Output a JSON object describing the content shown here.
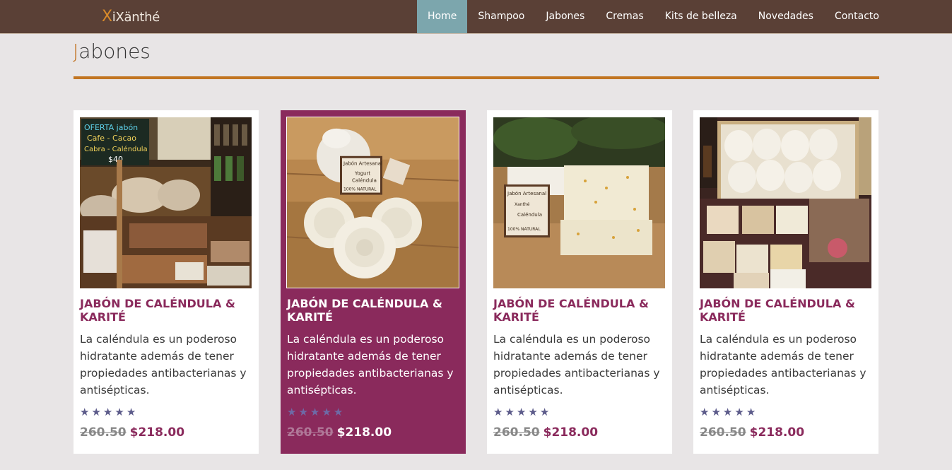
{
  "brand": {
    "logo_initial": "X",
    "logo_rest": "iXänthé"
  },
  "nav": [
    {
      "label": "Home",
      "active": true
    },
    {
      "label": "Shampoo"
    },
    {
      "label": "Jabones"
    },
    {
      "label": "Cremas"
    },
    {
      "label": "Kits de belleza"
    },
    {
      "label": "Novedades"
    },
    {
      "label": "Contacto"
    }
  ],
  "section": {
    "title_first": "J",
    "title_rest": "abones"
  },
  "products": [
    {
      "image": "soap-stall-photo",
      "title": "JABÓN DE CALÉNDULA & KARITÉ",
      "description": "La caléndula es un poderoso hidratante además de tener propiedades antibacterianas y antisépticas.",
      "rating": "5",
      "old_price": "260.50",
      "price": "$218.00"
    },
    {
      "image": "calendula-yogurt-soap-photo",
      "title": "JABÓN DE CALÉNDULA & KARITÉ",
      "description": "La caléndula es un poderoso hidratante además de tener propiedades antibacterianas y antisépticas.",
      "rating": "5",
      "old_price": "260.50",
      "price": "$218.00"
    },
    {
      "image": "calendula-bar-soap-photo",
      "title": "JABÓN DE CALÉNDULA & KARITÉ",
      "description": "La caléndula es un poderoso hidratante además de tener propiedades antibacterianas y antisépticas.",
      "rating": "5",
      "old_price": "260.50",
      "price": "$218.00"
    },
    {
      "image": "soap-box-display-photo",
      "title": "JABÓN DE CALÉNDULA & KARITÉ",
      "description": "La caléndula es un poderoso hidratante además de tener propiedades antibacterianas y antisépticas.",
      "rating": "5",
      "old_price": "260.50",
      "price": "$218.00"
    }
  ],
  "photo_text": {
    "sign": [
      "OFERTA jabón",
      "Cafe - Cacao",
      "Cabra - Caléndula",
      "$40"
    ],
    "label2": [
      "Jabón Artesanal",
      "Yogurt",
      "Caléndula",
      "100% NATURAL"
    ],
    "label3": [
      "Jabón Artesanal",
      "Xanthé",
      "Caléndula",
      "100% NATURAL"
    ]
  },
  "colors": {
    "topbar": "#5a4036",
    "nav_active": "#7ca6ad",
    "accent": "#c27522",
    "product_title": "#8a2a5c",
    "highlight_card": "#8a2a5c",
    "star": "#5c5b8a"
  }
}
